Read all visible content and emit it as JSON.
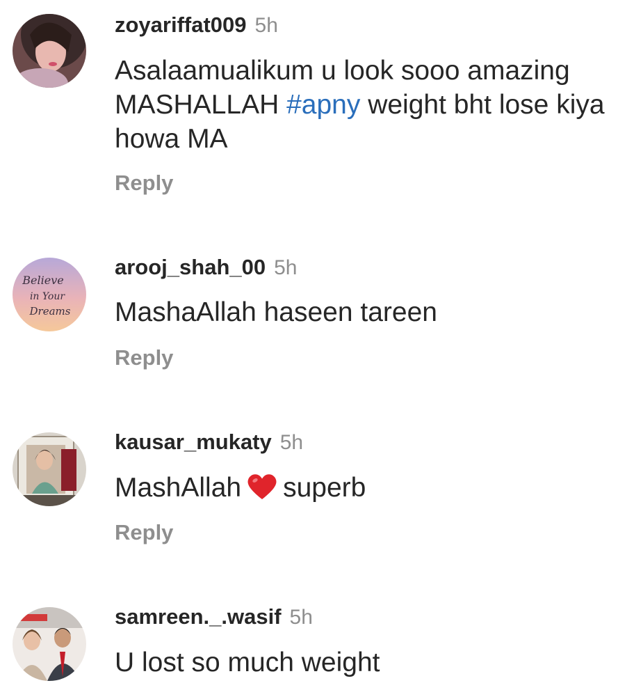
{
  "comments": [
    {
      "username": "zoyariffat009",
      "time": "5h",
      "text_before": "Asalaamualikum u look sooo amazing MASHALLAH ",
      "hashtag": "#apny",
      "text_after": " weight bht lose kiya howa MA",
      "reply_label": "Reply"
    },
    {
      "username": "arooj_shah_00",
      "time": "5h",
      "text": "MashaAllah haseen tareen",
      "avatar_text": [
        "Believe",
        "in Your",
        "Dreams"
      ],
      "reply_label": "Reply"
    },
    {
      "username": "kausar_mukaty",
      "time": "5h",
      "text_before": "MashAllah",
      "emoji": "heart-icon",
      "text_after": "superb",
      "reply_label": "Reply"
    },
    {
      "username": "samreen._.wasif",
      "time": "5h",
      "text": "U lost so much weight"
    }
  ],
  "colors": {
    "text": "#262626",
    "muted": "#8e8e8e",
    "hashtag": "#2a6ebb",
    "heart": "#e0242b"
  }
}
